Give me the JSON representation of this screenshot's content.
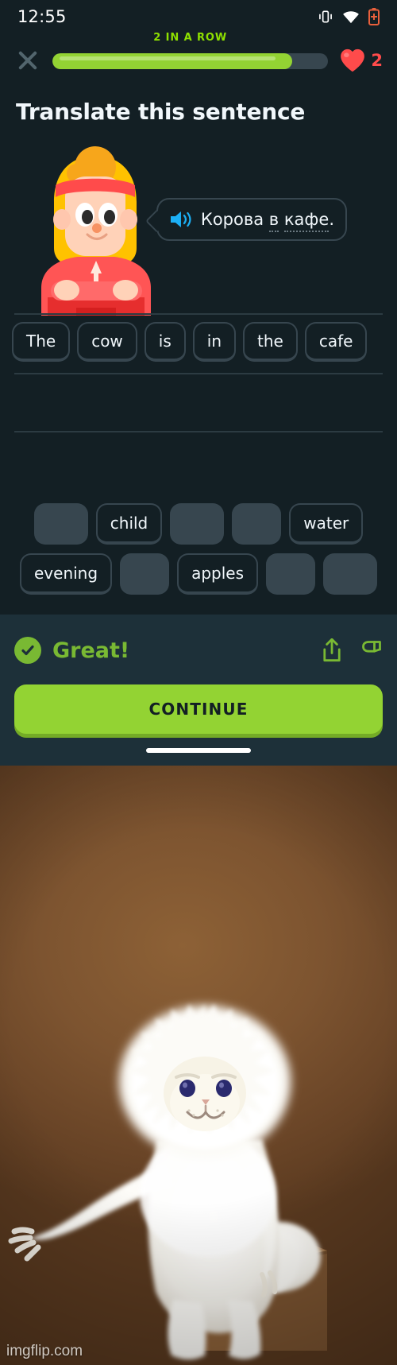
{
  "status_bar": {
    "time": "12:55",
    "icons": [
      "vibrate-icon",
      "wifi-icon",
      "battery-icon"
    ]
  },
  "top_bar": {
    "close_icon": "close-icon",
    "streak_label": "2 IN A ROW",
    "progress_percent": 87,
    "hearts_icon": "heart-icon",
    "hearts_count": "2"
  },
  "exercise": {
    "title": "Translate this sentence",
    "character": "duolingo-character-eddy",
    "bubble": {
      "speaker_icon": "speaker-icon",
      "text_plain": "Корова в кафе.",
      "word_1": "Корова",
      "word_2": "в",
      "word_3": "кафе",
      "punctuation": "."
    },
    "answer_tiles": [
      "The",
      "cow",
      "is",
      "in",
      "the",
      "cafe"
    ],
    "word_bank": [
      [
        {
          "label": "",
          "used": true
        },
        {
          "label": "child",
          "used": false
        },
        {
          "label": "",
          "used": true
        },
        {
          "label": "",
          "used": true
        },
        {
          "label": "water",
          "used": false
        }
      ],
      [
        {
          "label": "evening",
          "used": false
        },
        {
          "label": "",
          "used": true
        },
        {
          "label": "apples",
          "used": false
        },
        {
          "label": "",
          "used": true
        },
        {
          "label": "",
          "used": true
        }
      ]
    ]
  },
  "footer": {
    "result_icon": "check-circle-icon",
    "result_text": "Great!",
    "share_icon": "share-icon",
    "report_icon": "flag-icon",
    "continue_label": "CONTINUE"
  },
  "meme": {
    "subject": "white-persian-cat-on-box",
    "watermark": "imgflip.com"
  },
  "colors": {
    "background": "#131f24",
    "footer_background": "#1d3039",
    "green": "#93d333",
    "green_text": "#79b933",
    "red": "#ff4b4b",
    "tile_border": "#37464f",
    "text": "#f1f7fb",
    "speaker_blue": "#1cb0f6"
  }
}
